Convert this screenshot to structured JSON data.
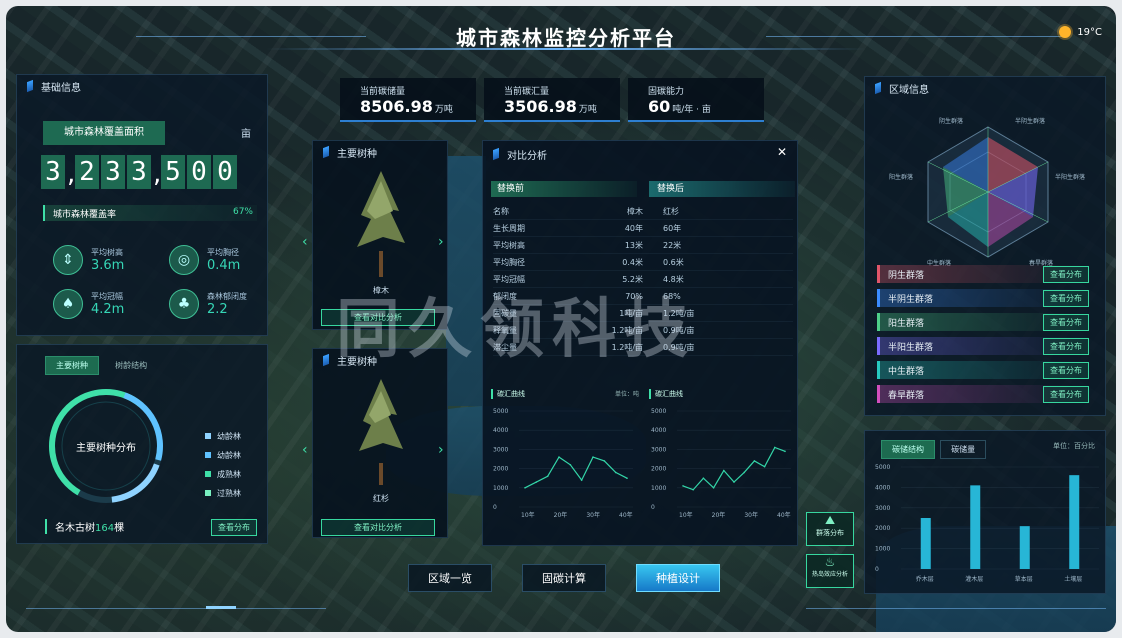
{
  "header": {
    "title": "城市森林监控分析平台",
    "weather": "19°C"
  },
  "stats": [
    {
      "label": "当前碳储量",
      "value": "8506.98",
      "unit": "万吨"
    },
    {
      "label": "当前碳汇量",
      "value": "3506.98",
      "unit": "万吨"
    },
    {
      "label": "固碳能力",
      "value": "60",
      "unit": "吨/年 · 亩"
    }
  ],
  "basic_info": {
    "title": "基础信息",
    "coverage_label": "城市森林覆盖面积",
    "coverage_unit": "亩",
    "digits": [
      "3",
      "2",
      "3",
      "3",
      "5",
      "0",
      "0"
    ],
    "rate_label": "城市森林覆盖率",
    "rate_value": "67%",
    "rate_fraction": 0.67,
    "metrics": [
      {
        "label": "平均树高",
        "value": "3.6m",
        "icon": "tree-height-icon"
      },
      {
        "label": "平均胸径",
        "value": "0.4m",
        "icon": "diameter-icon"
      },
      {
        "label": "平均冠幅",
        "value": "4.2m",
        "icon": "crown-icon"
      },
      {
        "label": "森林郁闭度",
        "value": "2.2",
        "icon": "forest-icon"
      }
    ]
  },
  "species": {
    "tabs": [
      "主要树种",
      "树龄结构"
    ],
    "center_label": "主要树种分布",
    "legend": [
      "幼龄林",
      "幼龄林",
      "成熟林",
      "过熟林"
    ],
    "legend_colors": [
      "#8fd3ff",
      "#5fc2ff",
      "#3fe0a8",
      "#7af0c0"
    ],
    "ancient_label": "名木古树",
    "ancient_count": "164",
    "ancient_unit": "棵",
    "view_btn": "查看分布"
  },
  "main_trees": {
    "title": "主要树种",
    "cards": [
      {
        "name": "樟木",
        "button": "查看对比分析"
      },
      {
        "name": "红杉",
        "button": "查看对比分析"
      }
    ]
  },
  "comparison": {
    "title": "对比分析",
    "before_label": "替换前",
    "after_label": "替换后",
    "rows": [
      [
        "名称",
        "樟木",
        "红杉"
      ],
      [
        "生长周期",
        "40年",
        "60年"
      ],
      [
        "平均树高",
        "13米",
        "22米"
      ],
      [
        "平均胸径",
        "0.4米",
        "0.6米"
      ],
      [
        "平均冠幅",
        "5.2米",
        "4.8米"
      ],
      [
        "郁闭度",
        "70%",
        "68%"
      ],
      [
        "固碳量",
        "1吨/亩",
        "1.2吨/亩"
      ],
      [
        "释氧量",
        "1.2吨/亩",
        "0.9吨/亩"
      ],
      [
        "滞尘量",
        "1.2吨/亩",
        "0.9吨/亩"
      ]
    ],
    "chart_title": "碳汇曲线",
    "chart_unit": "单位：吨"
  },
  "chart_data": [
    {
      "type": "line",
      "title": "碳汇曲线",
      "ylim": [
        0,
        5000
      ],
      "yticks": [
        "5000",
        "4000",
        "3000",
        "2000",
        "1000",
        "0"
      ],
      "categories": [
        "10年",
        "20年",
        "30年",
        "40年"
      ],
      "series": [
        {
          "values": [
            1000,
            1300,
            1600,
            2600,
            2200,
            1400,
            2600,
            2400,
            1800,
            1500
          ]
        }
      ]
    },
    {
      "type": "line",
      "title": "碳汇曲线",
      "ylim": [
        0,
        5000
      ],
      "yticks": [
        "5000",
        "4000",
        "3000",
        "2000",
        "1000",
        "0"
      ],
      "categories": [
        "10年",
        "20年",
        "30年",
        "40年"
      ],
      "series": [
        {
          "values": [
            1100,
            900,
            1500,
            1000,
            1900,
            1300,
            1800,
            2400,
            2100,
            3100,
            2900
          ]
        }
      ]
    },
    {
      "type": "bar",
      "ylim": [
        0,
        5000
      ],
      "yticks": [
        "5000",
        "4000",
        "3000",
        "2000",
        "1000",
        "0"
      ],
      "categories": [
        "乔木层",
        "灌木层",
        "草本层",
        "土壤层"
      ],
      "values": [
        2500,
        4100,
        2100,
        4600
      ]
    }
  ],
  "region": {
    "title": "区域信息",
    "radar_labels": [
      "阴生群落",
      "半阴生群落",
      "半阳生群落",
      "春旱群落",
      "中生群落",
      "阳生群落"
    ],
    "items": [
      {
        "label": "阴生群落",
        "color": "#e0566a"
      },
      {
        "label": "半阴生群落",
        "color": "#3b8bff"
      },
      {
        "label": "阳生群落",
        "color": "#4ed08a"
      },
      {
        "label": "半阳生群落",
        "color": "#7b6cff"
      },
      {
        "label": "中生群落",
        "color": "#27c9c0"
      },
      {
        "label": "春旱群落",
        "color": "#d24fbd"
      }
    ],
    "view_btn": "查看分布"
  },
  "bottom_right": {
    "tabs": [
      "碳储结构",
      "碳储量"
    ],
    "unit": "单位：百分比"
  },
  "side_buttons": [
    "群落分布",
    "热岛效应分析"
  ],
  "bottom_nav": [
    "区域一览",
    "固碳计算",
    "种植设计"
  ],
  "watermark": "同久领科技"
}
